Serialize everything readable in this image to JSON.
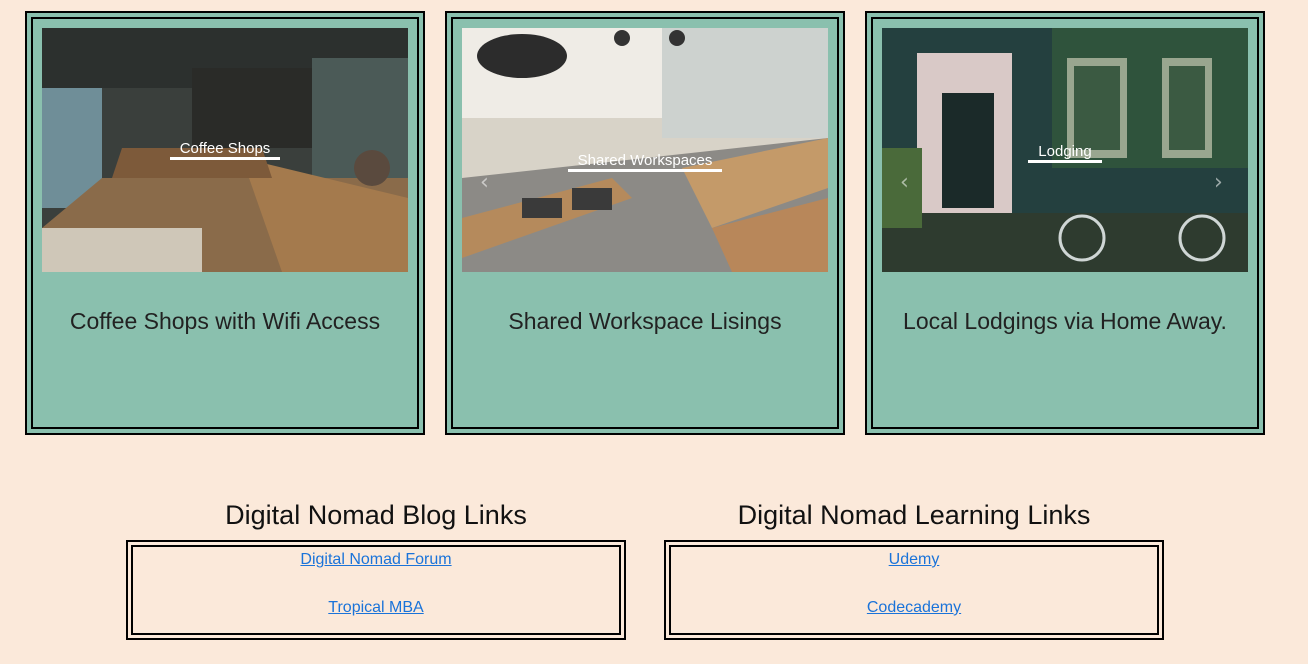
{
  "cards": [
    {
      "caption": "Coffee Shops",
      "title": "Coffee Shops with Wifi Access",
      "prev_icon": "chevron-left-icon",
      "next_icon": "chevron-right-icon"
    },
    {
      "caption": "Shared Workspaces",
      "title": "Shared Workspace Lisings",
      "prev_icon": "chevron-left-icon",
      "next_icon": "chevron-right-icon"
    },
    {
      "caption": "Lodging",
      "title": "Local Lodgings via Home Away.",
      "prev_icon": "chevron-left-icon",
      "next_icon": "chevron-right-icon"
    }
  ],
  "blog_links": {
    "title": "Digital Nomad Blog Links",
    "links": [
      "Digital Nomad Forum ",
      "Tropical MBA "
    ]
  },
  "learning_links": {
    "title": "Digital Nomad Learning Links",
    "links": [
      "Udemy ",
      "Codecademy "
    ]
  },
  "colors": {
    "background": "#fbe9da",
    "card": "#8ac0ae",
    "link": "#1a73d9"
  }
}
